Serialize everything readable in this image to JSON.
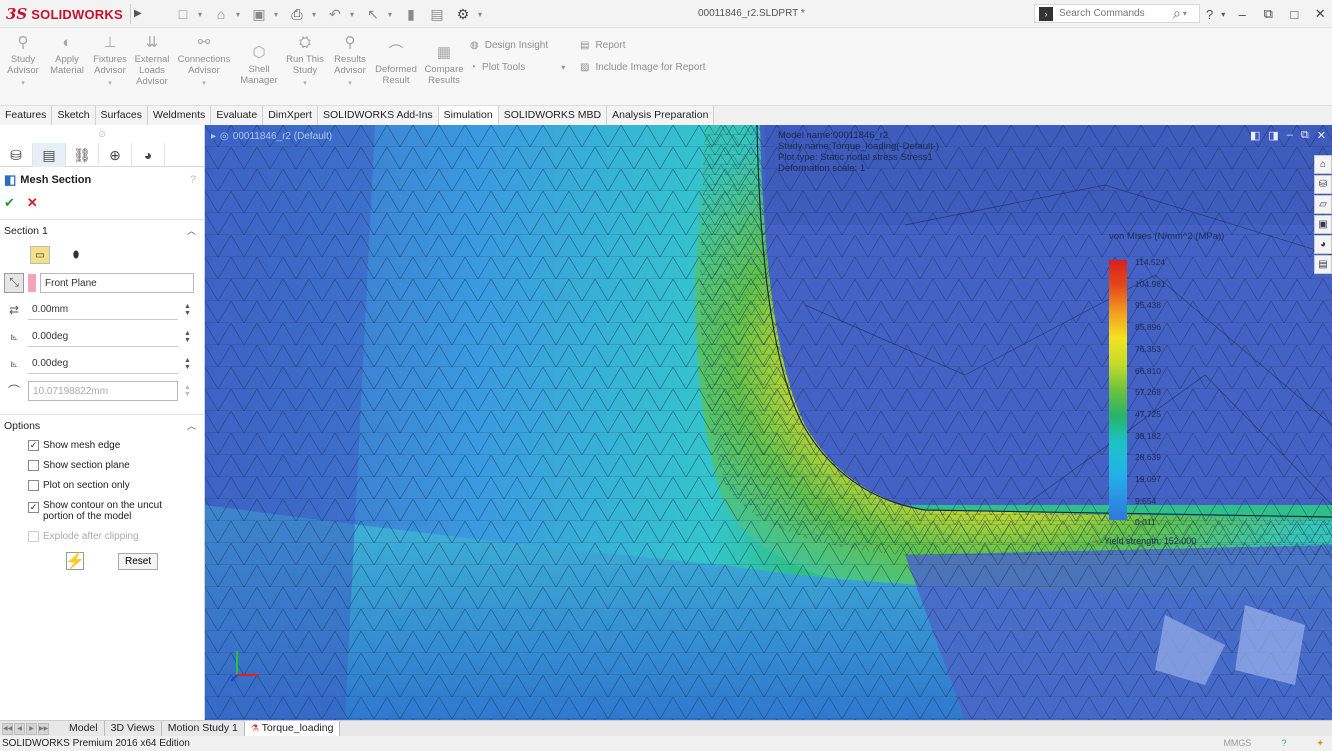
{
  "app": {
    "logo_mark": "3S",
    "logo_text": "SOLIDWORKS",
    "document_title": "00011846_r2.SLDPRT *",
    "search_placeholder": "Search Commands"
  },
  "ribbon": {
    "buttons": [
      {
        "label": "Study\nAdvisor",
        "icon": "study-advisor-icon"
      },
      {
        "label": "Apply\nMaterial",
        "icon": "apply-material-icon"
      },
      {
        "label": "Fixtures\nAdvisor",
        "icon": "fixtures-advisor-icon"
      },
      {
        "label": "External\nLoads\nAdvisor",
        "icon": "external-loads-icon"
      },
      {
        "label": "Connections\nAdvisor",
        "icon": "connections-advisor-icon"
      },
      {
        "label": "Shell\nManager",
        "icon": "shell-manager-icon"
      },
      {
        "label": "Run This\nStudy",
        "icon": "run-study-icon"
      },
      {
        "label": "Results\nAdvisor",
        "icon": "results-advisor-icon"
      },
      {
        "label": "Deformed\nResult",
        "icon": "deformed-result-icon"
      },
      {
        "label": "Compare\nResults",
        "icon": "compare-results-icon"
      }
    ],
    "design_insight": "Design Insight",
    "plot_tools": "Plot Tools",
    "report": "Report",
    "include_image": "Include Image for Report"
  },
  "command_tabs": [
    "Features",
    "Sketch",
    "Surfaces",
    "Weldments",
    "Evaluate",
    "DimXpert",
    "SOLIDWORKS Add-Ins",
    "Simulation",
    "SOLIDWORKS MBD",
    "Analysis Preparation"
  ],
  "command_tabs_active": "Simulation",
  "property_manager": {
    "title": "Mesh Section",
    "section_title": "Section 1",
    "plane": "Front Plane",
    "offset": "0.00mm",
    "angle1": "0.00deg",
    "angle2": "0.00deg",
    "radius": "10.07198822mm",
    "options_title": "Options",
    "options": [
      {
        "label": "Show mesh edge",
        "checked": true,
        "disabled": false
      },
      {
        "label": "Show section plane",
        "checked": false,
        "disabled": false
      },
      {
        "label": "Plot on section only",
        "checked": false,
        "disabled": false
      },
      {
        "label": "Show contour on the uncut portion of the model",
        "checked": true,
        "disabled": false
      },
      {
        "label": "Explode after clipping",
        "checked": false,
        "disabled": true
      }
    ],
    "reset_label": "Reset"
  },
  "viewport": {
    "tree_label": "00011846_r2 (Default)",
    "info_lines": [
      "Model name:00011846_r2",
      "Study name:Torque_loading(-Default-)",
      "Plot type: Static nodal stress Stress1",
      "Deformation scale: 1"
    ],
    "legend_title": "von Mises (N/mm^2 (MPa))",
    "legend_ticks": [
      "114.524",
      "104.981",
      "95.438",
      "85.896",
      "76.353",
      "66.810",
      "57.268",
      "47.725",
      "38.182",
      "28.639",
      "19.097",
      "9.554",
      "0.011"
    ],
    "yield_label": "Yield strength: 152.000"
  },
  "bottom_tabs": [
    "Model",
    "3D Views",
    "Motion Study 1",
    "Torque_loading"
  ],
  "bottom_tabs_active": "Torque_loading",
  "status": {
    "edition": "SOLIDWORKS Premium 2016 x64 Edition",
    "units": "MMGS"
  }
}
